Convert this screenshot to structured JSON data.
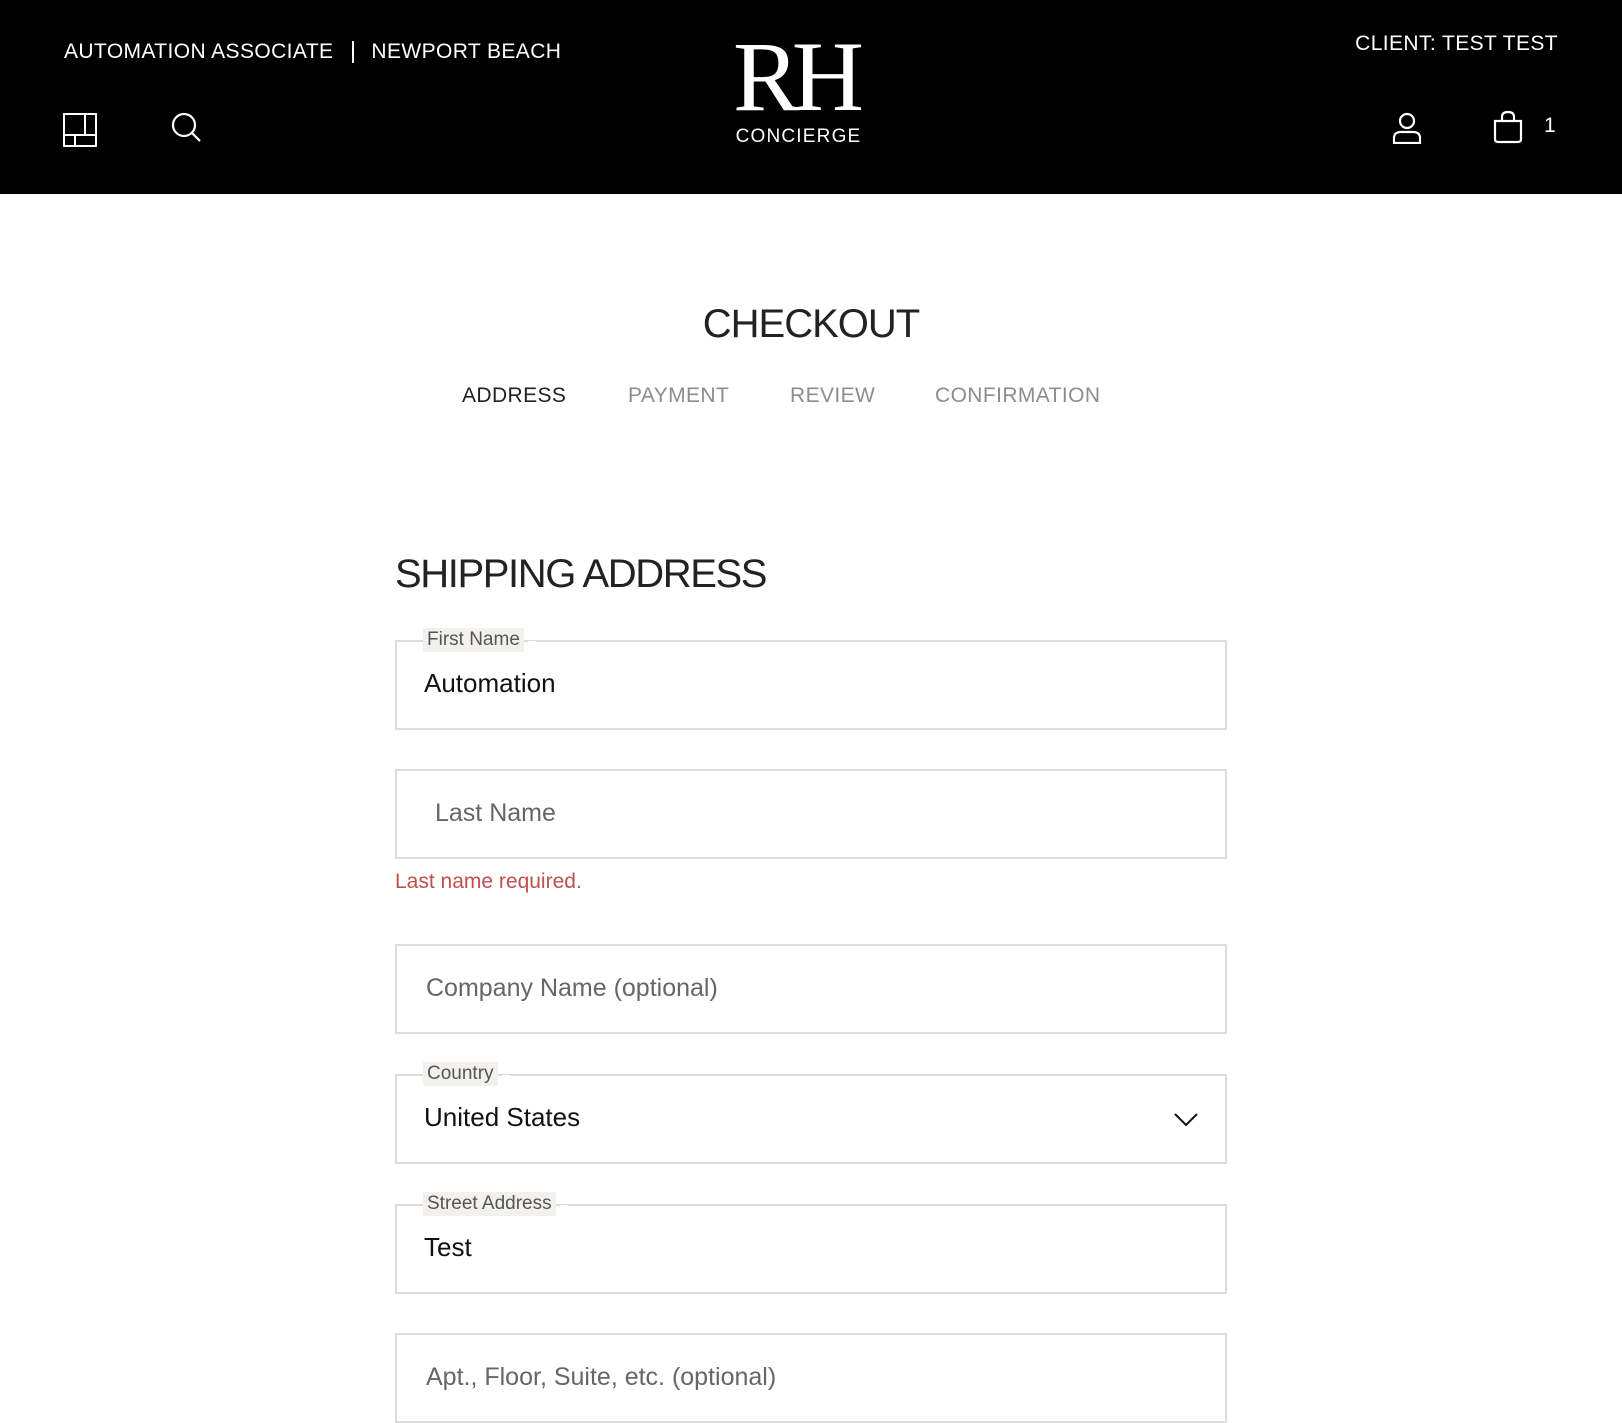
{
  "header": {
    "associate": "AUTOMATION ASSOCIATE",
    "location": "NEWPORT BEACH",
    "logo_mark": "RH",
    "logo_sub": "CONCIERGE",
    "client": "CLIENT: TEST TEST",
    "cart_count": "1",
    "icons": [
      "grid-icon",
      "search-icon",
      "account-icon",
      "cart-icon"
    ]
  },
  "checkout": {
    "title": "CHECKOUT",
    "steps": [
      {
        "label": "ADDRESS",
        "active": true
      },
      {
        "label": "PAYMENT",
        "active": false
      },
      {
        "label": "REVIEW",
        "active": false
      },
      {
        "label": "CONFIRMATION",
        "active": false
      }
    ]
  },
  "shipping": {
    "title": "SHIPPING ADDRESS",
    "first_name": {
      "label": "First Name",
      "value": "Automation"
    },
    "last_name": {
      "placeholder": "Last Name",
      "error": "Last name required."
    },
    "company": {
      "placeholder": "Company Name (optional)"
    },
    "country": {
      "label": "Country",
      "value": "United States"
    },
    "street": {
      "label": "Street Address",
      "value": "Test"
    },
    "apt": {
      "placeholder": "Apt., Floor, Suite, etc. (optional)"
    }
  },
  "colors": {
    "header_bg": "#000000",
    "error": "#c0504d",
    "inactive_step": "#8d8d8d",
    "border": "#dcdcdc"
  }
}
